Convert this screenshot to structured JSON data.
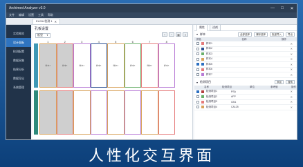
{
  "app": {
    "title": "Archimed Analyzer v3.0",
    "window_controls": [
      "—",
      "□",
      "✕"
    ]
  },
  "menu": [
    "文件",
    "编辑",
    "设置",
    "工具",
    "帮助"
  ],
  "tab": {
    "label": "ELISA 检测 1",
    "close": "✕"
  },
  "sidebar": [
    {
      "label": "实验概览",
      "active": false
    },
    {
      "label": "设计面板",
      "active": true
    },
    {
      "label": "检测配置",
      "active": false
    },
    {
      "label": "数据采集",
      "active": false
    },
    {
      "label": "结果分析",
      "active": false
    },
    {
      "label": "数据导出",
      "active": false
    },
    {
      "label": "系统管理",
      "active": false
    }
  ],
  "plate": {
    "title": "孔板设置",
    "dropdown": "板型",
    "columns": [
      "1",
      "2",
      "3",
      "4",
      "5",
      "6",
      "7",
      "8"
    ],
    "rows": [
      {
        "cells": [
          {
            "label": "样本1",
            "color": "#d8a25b",
            "selected": true
          },
          {
            "label": "样本1",
            "color": "#e57b7b",
            "selected": true
          },
          {
            "label": "样本1",
            "color": "#b87bd6",
            "selected": false
          },
          {
            "label": "样本1",
            "color": "#2b4f93",
            "selected": false
          },
          {
            "label": "样本1",
            "color": "#d8a25b",
            "selected": false
          },
          {
            "label": "样本1",
            "color": "#6ab06a",
            "selected": false
          },
          {
            "label": "样本1",
            "color": "#e57b7b",
            "selected": false
          },
          {
            "label": "样本1",
            "color": "#b87bd6",
            "selected": false
          }
        ]
      },
      {
        "cells": [
          {
            "label": "",
            "color": "#d8a25b",
            "selected": true
          },
          {
            "label": "",
            "color": "#e57b7b",
            "selected": true
          },
          {
            "label": "",
            "color": "#d8a25b",
            "selected": false
          },
          {
            "label": "",
            "color": "#b87bd6",
            "selected": false
          },
          {
            "label": "",
            "color": "#d8a25b",
            "selected": false
          },
          {
            "label": "",
            "color": "#b87bd6",
            "selected": false
          },
          {
            "label": "",
            "color": "#d8a25b",
            "selected": false
          },
          {
            "label": "",
            "color": "#e57b7b",
            "selected": false
          }
        ]
      }
    ]
  },
  "right": {
    "tabs": [
      "属性",
      "试剂"
    ],
    "top_panel": {
      "title": "样本",
      "buttons": [
        "全部选择",
        "清除选择",
        "批量导入",
        "导出"
      ],
      "header": [
        "颜色",
        "名称",
        "操作"
      ],
      "rows": [
        {
          "checked": false,
          "color": "#e57b7b",
          "name": "样本1"
        },
        {
          "checked": false,
          "color": "#2b4f93",
          "name": "样本2"
        },
        {
          "checked": false,
          "color": "#6ab06a",
          "name": "样本3"
        },
        {
          "checked": false,
          "color": "#d8a25b",
          "name": "样本4"
        },
        {
          "checked": true,
          "color": "#2b6fc1",
          "name": "样本5"
        },
        {
          "checked": false,
          "color": "#e57b7b",
          "name": "样本6"
        },
        {
          "checked": false,
          "color": "#b87bd6",
          "name": "样本7"
        }
      ]
    },
    "bottom_panel": {
      "title": "检测项目",
      "buttons": [
        "添加",
        "搜索"
      ],
      "header": [
        "名称",
        "检测项目",
        "单位",
        "参考值",
        "操作"
      ],
      "rows": [
        {
          "checked": true,
          "color": "#b54040",
          "name": "检测项目1",
          "item": "PSA"
        },
        {
          "checked": false,
          "color": "#6ab06a",
          "name": "检测项目2",
          "item": "AFP"
        },
        {
          "checked": false,
          "color": "#e57b7b",
          "name": "检测项目3",
          "item": "CEA"
        },
        {
          "checked": false,
          "color": "#d8a25b",
          "name": "检测项目4",
          "item": "CA125"
        }
      ]
    }
  },
  "caption": "人性化交互界面"
}
